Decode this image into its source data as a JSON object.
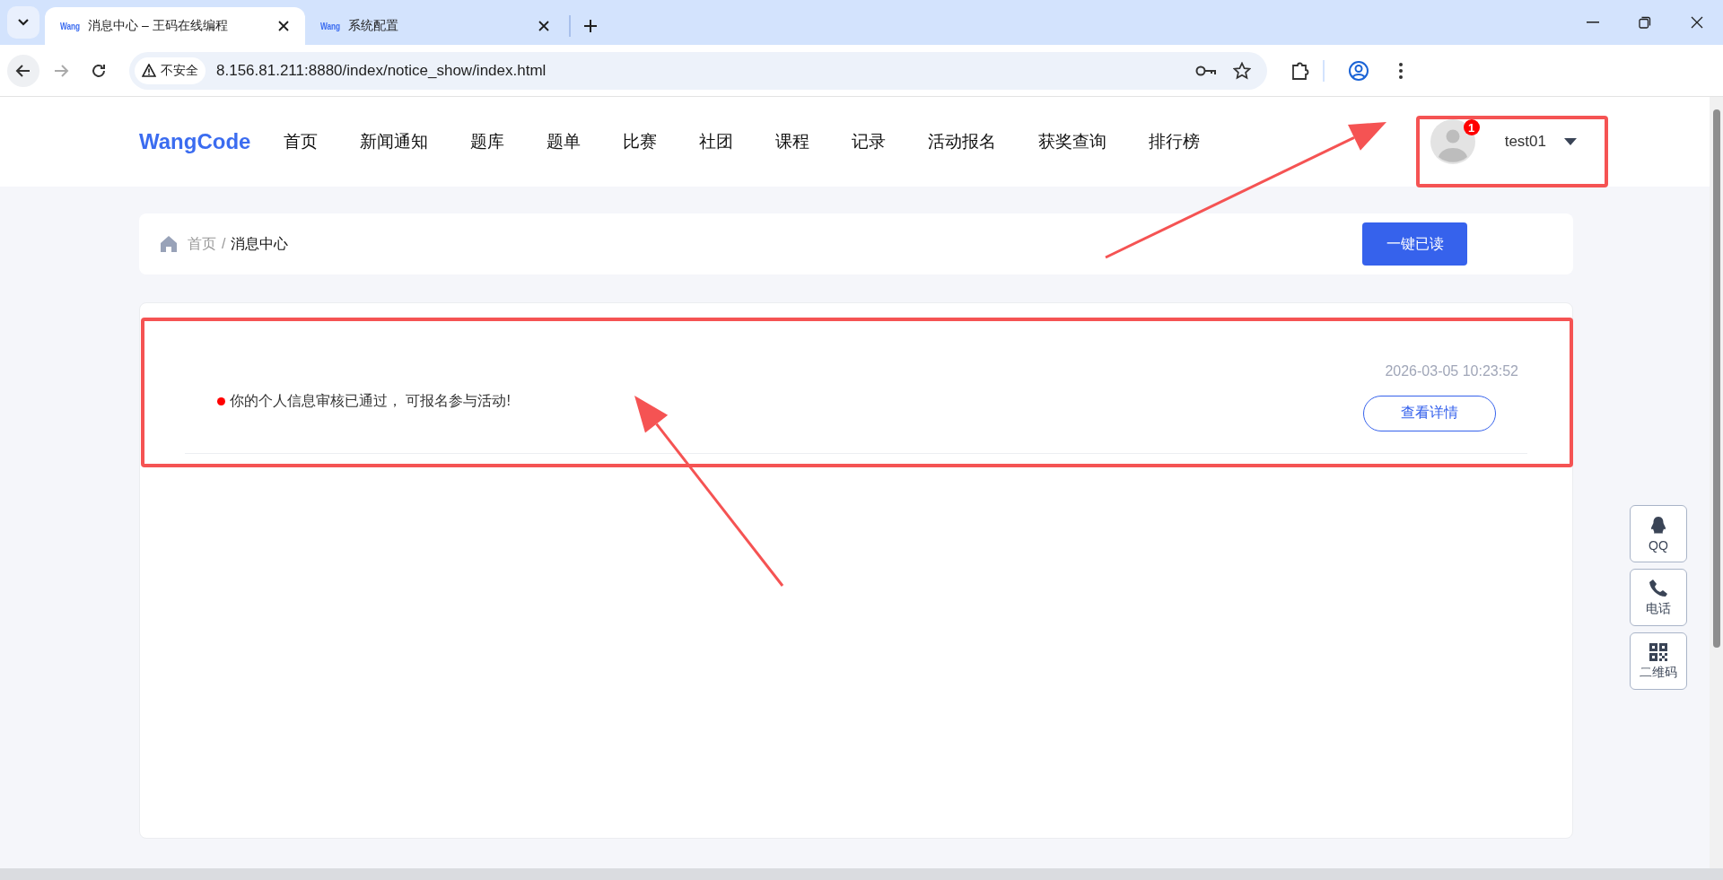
{
  "browser": {
    "tabs": [
      {
        "favicon": "Wang",
        "title": "消息中心 – 王码在线编程",
        "selected": true
      },
      {
        "favicon": "Wang",
        "title": "系统配置",
        "selected": false
      }
    ],
    "security_label": "不安全",
    "url": "8.156.81.211:8880/index/notice_show/index.html"
  },
  "header": {
    "logo": "WangCode",
    "nav": [
      "首页",
      "新闻通知",
      "题库",
      "题单",
      "比赛",
      "社团",
      "课程",
      "记录",
      "活动报名",
      "获奖查询",
      "排行榜"
    ],
    "user": {
      "name": "test01",
      "badge": "1"
    }
  },
  "breadcrumb": {
    "items": [
      {
        "label": "首页",
        "current": false
      },
      {
        "label": "消息中心",
        "current": true
      }
    ],
    "separator": "/"
  },
  "mark_all_read": "一键已读",
  "notices": [
    {
      "text": "你的个人信息审核已通过， 可报名参与活动!",
      "unread": true,
      "time": "2026-03-05 10:23:52",
      "action": "查看详情"
    }
  ],
  "side_tools": [
    {
      "kind": "qq",
      "label": "QQ"
    },
    {
      "kind": "phone",
      "label": "电话"
    },
    {
      "kind": "qrcode",
      "label": "二维码"
    }
  ]
}
